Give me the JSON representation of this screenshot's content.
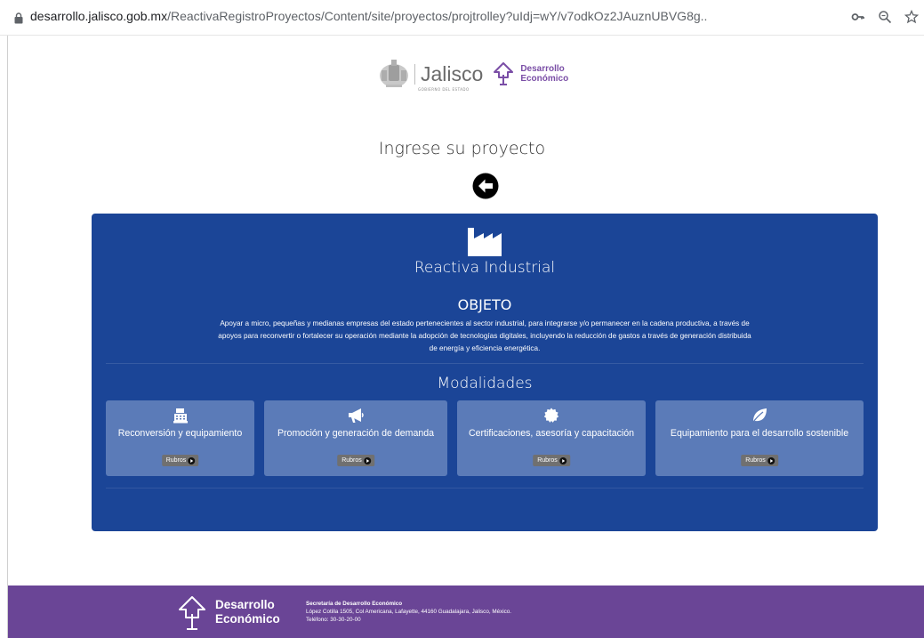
{
  "browser": {
    "url_host": "desarrollo.jalisco.gob.mx",
    "url_path": "/ReactivaRegistroProyectos/Content/site/proyectos/projtrolley?uIdj=wY/v7odkOz2JAuznUBVG8g.."
  },
  "header": {
    "jalisco_word": "Jalisco",
    "jalisco_sub": "GOBIERNO DEL ESTADO",
    "de_line1": "Desarrollo",
    "de_line2": "Económico"
  },
  "page": {
    "title": "Ingrese su proyecto"
  },
  "card": {
    "title": "Reactiva Industrial",
    "objeto_heading": "OBJETO",
    "objeto_text": "Apoyar a micro, pequeñas y medianas empresas del estado pertenecientes al sector industrial, para integrarse y/o permanecer en la cadena productiva, a través de apoyos para reconvertir o fortalecer su operación mediante la adopción de tecnologías digitales, incluyendo la reducción de gastos a través de generación distribuida de energía y eficiencia energética.",
    "modalidades_heading": "Modalidades",
    "modalidades": [
      {
        "label": "Reconversión y equipamiento",
        "icon": "cash-register-icon",
        "button": "Rubros"
      },
      {
        "label": "Promoción y generación de demanda",
        "icon": "megaphone-icon",
        "button": "Rubros"
      },
      {
        "label": "Certificaciones, asesoría y capacitación",
        "icon": "certificate-icon",
        "button": "Rubros"
      },
      {
        "label": "Equipamiento para el desarrollo sostenible",
        "icon": "leaf-icon",
        "button": "Rubros"
      }
    ]
  },
  "footer": {
    "de_line1": "Desarrollo",
    "de_line2": "Económico",
    "org": "Secretaría de Desarrollo Económico",
    "address": "López Cotilla 1505, Col Americana, Lafayette, 44160 Guadalajara, Jalisco, México.",
    "phone": "Teléfono: 30-30-20-00"
  },
  "colors": {
    "card_blue": "#1b4597",
    "modality_tile": "#5b7bb8",
    "footer_purple": "#6a4596",
    "brand_purple": "#7a4ea6"
  }
}
